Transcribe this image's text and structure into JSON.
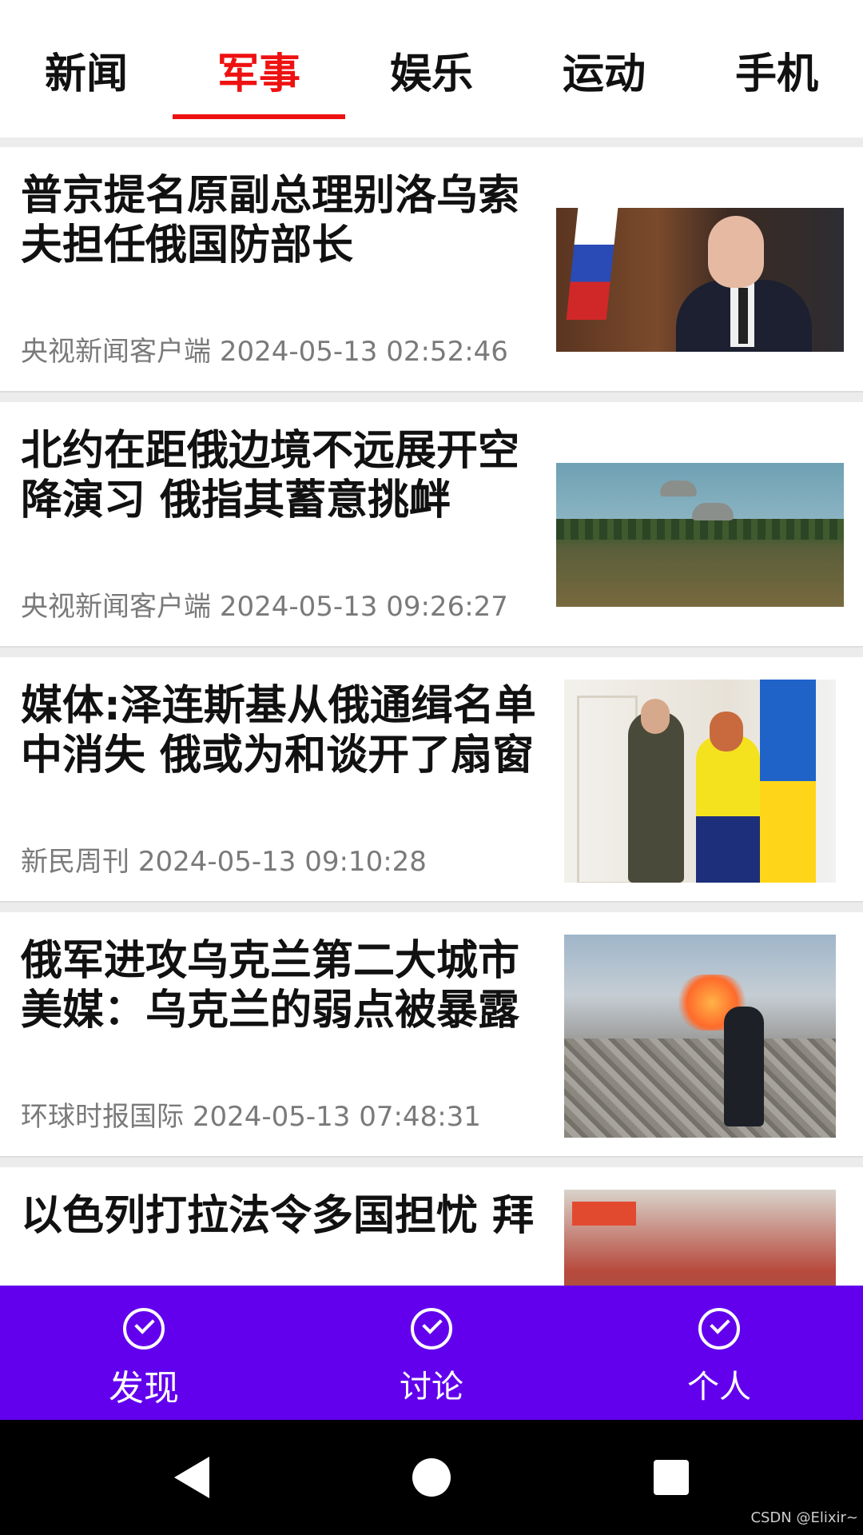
{
  "tabs": [
    {
      "label": "新闻",
      "active": false
    },
    {
      "label": "军事",
      "active": true
    },
    {
      "label": "娱乐",
      "active": false
    },
    {
      "label": "运动",
      "active": false
    },
    {
      "label": "手机",
      "active": false
    }
  ],
  "articles": [
    {
      "title": "普京提名原副总理别洛乌索夫担任俄国防部长",
      "source": "央视新闻客户端",
      "time": "2024-05-13 02:52:46",
      "image": "putin-photo"
    },
    {
      "title": "北约在距俄边境不远展开空降演习 俄指其蓄意挑衅",
      "source": "央视新闻客户端",
      "time": "2024-05-13 09:26:27",
      "image": "parachute-drill-photo"
    },
    {
      "title": "媒体:泽连斯基从俄通缉名单中消失 俄或为和谈开了扇窗",
      "source": "新民周刊",
      "time": "2024-05-13 09:10:28",
      "image": "zelensky-photo"
    },
    {
      "title": "俄军进攻乌克兰第二大城市 美媒：乌克兰的弱点被暴露",
      "source": "环球时报国际",
      "time": "2024-05-13 07:48:31",
      "image": "ruins-photo"
    },
    {
      "title": "以色列打拉法令多国担忧 拜",
      "source": "",
      "time": "",
      "image": "street-photo"
    }
  ],
  "bottom_nav": [
    {
      "label": "发现",
      "icon": "check-circle-icon",
      "active": true
    },
    {
      "label": "讨论",
      "icon": "check-circle-icon",
      "active": false
    },
    {
      "label": "个人",
      "icon": "check-circle-icon",
      "active": false
    }
  ],
  "colors": {
    "accent": "#ee1111",
    "nav_bg": "#6200ee",
    "meta_text": "#7a7a7a"
  },
  "watermark": "CSDN @Elixir~"
}
